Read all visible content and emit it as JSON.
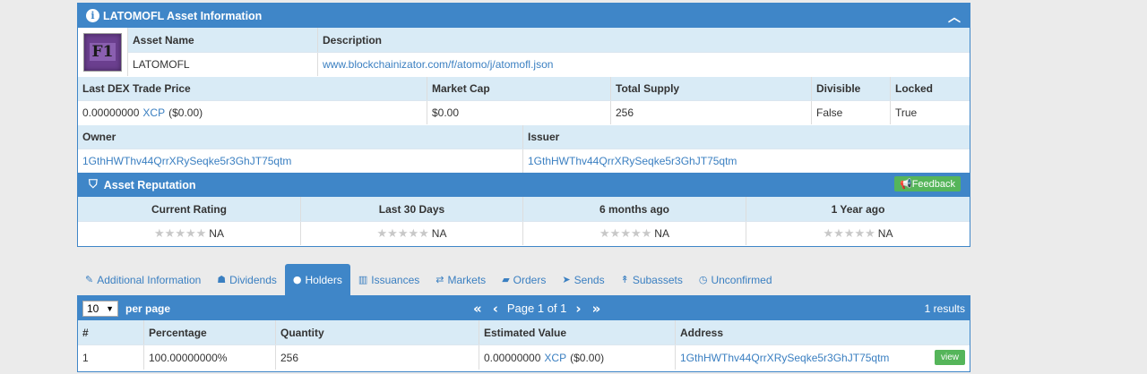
{
  "asset_panel": {
    "title": "LATOMOFL Asset Information",
    "icon_text": "F1",
    "asset_name_header": "Asset Name",
    "description_header": "Description",
    "asset_name": "LATOMOFL",
    "description": "www.blockchainizator.com/f/atomo/j/atomofl.json",
    "headers": {
      "last_dex": "Last DEX Trade Price",
      "market_cap": "Market Cap",
      "total_supply": "Total Supply",
      "divisible": "Divisible",
      "locked": "Locked"
    },
    "values": {
      "price_amount": "0.00000000",
      "price_unit": "XCP",
      "price_usd": "($0.00)",
      "market_cap": "$0.00",
      "total_supply": "256",
      "divisible": "False",
      "locked": "True"
    },
    "owner_header": "Owner",
    "issuer_header": "Issuer",
    "owner": "1GthHWThv44QrrXRySeqke5r3GhJT75qtm",
    "issuer": "1GthHWThv44QrrXRySeqke5r3GhJT75qtm"
  },
  "reputation": {
    "title": "Asset Reputation",
    "feedback_label": "Feedback",
    "columns": [
      "Current Rating",
      "Last 30 Days",
      "6 months ago",
      "1 Year ago"
    ],
    "ratings": [
      "NA",
      "NA",
      "NA",
      "NA"
    ]
  },
  "tabs": [
    {
      "label": "Additional Information",
      "icon": "paperclip-icon",
      "glyph": "✎"
    },
    {
      "label": "Dividends",
      "icon": "sitemap-icon",
      "glyph": "☗"
    },
    {
      "label": "Holders",
      "icon": "user-icon",
      "glyph": "●"
    },
    {
      "label": "Issuances",
      "icon": "bank-icon",
      "glyph": "▥"
    },
    {
      "label": "Markets",
      "icon": "exchange-icon",
      "glyph": "⇄"
    },
    {
      "label": "Orders",
      "icon": "book-icon",
      "glyph": "▰"
    },
    {
      "label": "Sends",
      "icon": "paper-plane-icon",
      "glyph": "➤"
    },
    {
      "label": "Subassets",
      "icon": "pin-icon",
      "glyph": "↟"
    },
    {
      "label": "Unconfirmed",
      "icon": "clock-icon",
      "glyph": "◷"
    }
  ],
  "active_tab": "Holders",
  "holders": {
    "per_page_value": "10",
    "per_page_label": "per page",
    "page_text": "Page 1 of 1",
    "results_text": "1 results",
    "columns": [
      "#",
      "Percentage",
      "Quantity",
      "Estimated Value",
      "Address"
    ],
    "rows": [
      {
        "num": "1",
        "percentage": "100.00000000%",
        "quantity": "256",
        "value_amount": "0.00000000",
        "value_unit": "XCP",
        "value_usd": "($0.00)",
        "address": "1GthHWThv44QrrXRySeqke5r3GhJT75qtm",
        "action": "view"
      }
    ]
  },
  "colors": {
    "header_blue": "#3f86c8",
    "light_blue": "#d9ebf6",
    "link_blue": "#3a7fc1",
    "button_green": "#55b55a"
  }
}
